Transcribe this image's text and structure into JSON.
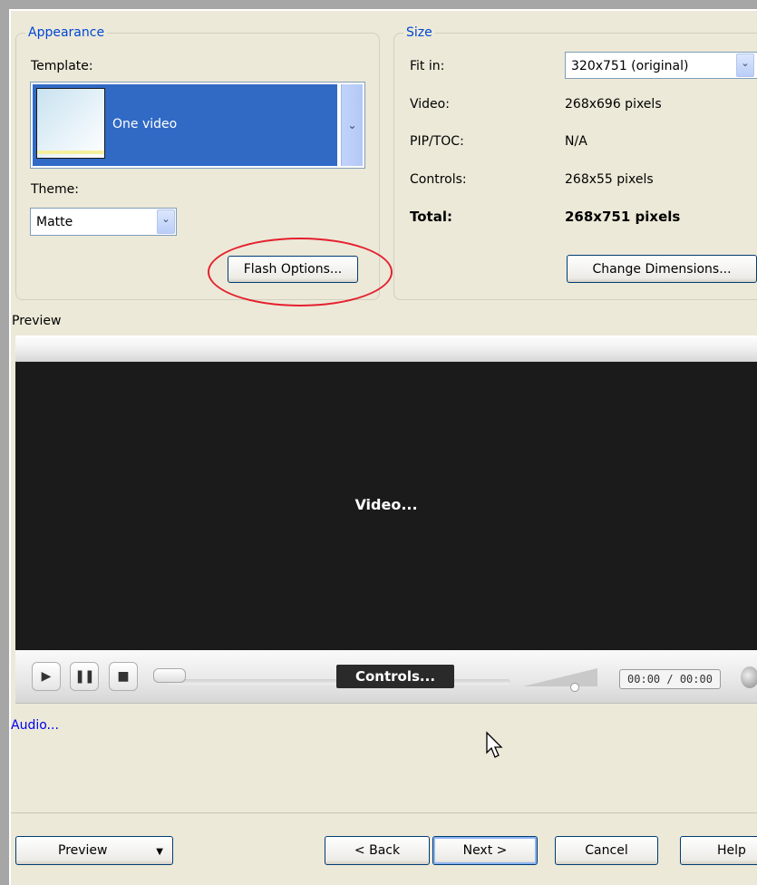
{
  "appearance": {
    "legend": "Appearance",
    "template_label": "Template:",
    "template_selected": "One video",
    "theme_label": "Theme:",
    "theme_value": "Matte",
    "flash_options_button": "Flash Options..."
  },
  "size": {
    "legend": "Size",
    "fit_in_label": "Fit in:",
    "fit_in_value": "320x751 (original)",
    "video_label": "Video:",
    "video_value": "268x696 pixels",
    "pip_label": "PIP/TOC:",
    "pip_value": "N/A",
    "controls_label": "Controls:",
    "controls_value": "268x55 pixels",
    "total_label": "Total:",
    "total_value": "268x751 pixels",
    "change_dimensions_button": "Change Dimensions..."
  },
  "preview": {
    "label": "Preview",
    "video_text": "Video...",
    "controls_text": "Controls...",
    "time_display": "00:00 / 00:00",
    "audio_text": "Audio..."
  },
  "footer": {
    "preview_button": "Preview",
    "back_button": "< Back",
    "next_button": "Next >",
    "cancel_button": "Cancel",
    "help_button": "Help"
  },
  "colors": {
    "selection": "#316ac5",
    "legend_text": "#0046d5",
    "annotation_circle": "#e5202e"
  }
}
